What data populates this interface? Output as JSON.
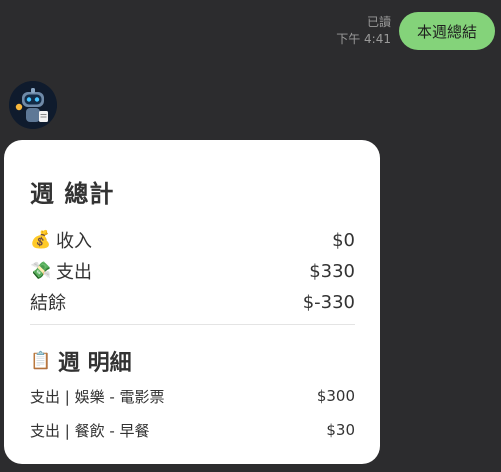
{
  "message_status": {
    "read_label": "已讀",
    "time": "下午 4:41"
  },
  "user_message": {
    "text": "本週總結"
  },
  "bot": {
    "avatar_icon": "robot-icon"
  },
  "card": {
    "title": "週 總計",
    "income": {
      "icon": "money-bag-icon",
      "label": "收入",
      "value": "$0"
    },
    "expense": {
      "icon": "money-wings-icon",
      "label": "支出",
      "value": "$330"
    },
    "balance": {
      "label": "結餘",
      "value": "$-330"
    },
    "details": {
      "icon": "clipboard-icon",
      "title": "週 明細",
      "items": [
        {
          "label": "支出 | 娛樂 - 電影票",
          "value": "$300"
        },
        {
          "label": "支出 | 餐飲 - 早餐",
          "value": "$30"
        }
      ]
    }
  },
  "colors": {
    "background": "#2c2c2e",
    "user_bubble": "#84d37a",
    "card": "#ffffff",
    "text": "#333333"
  }
}
